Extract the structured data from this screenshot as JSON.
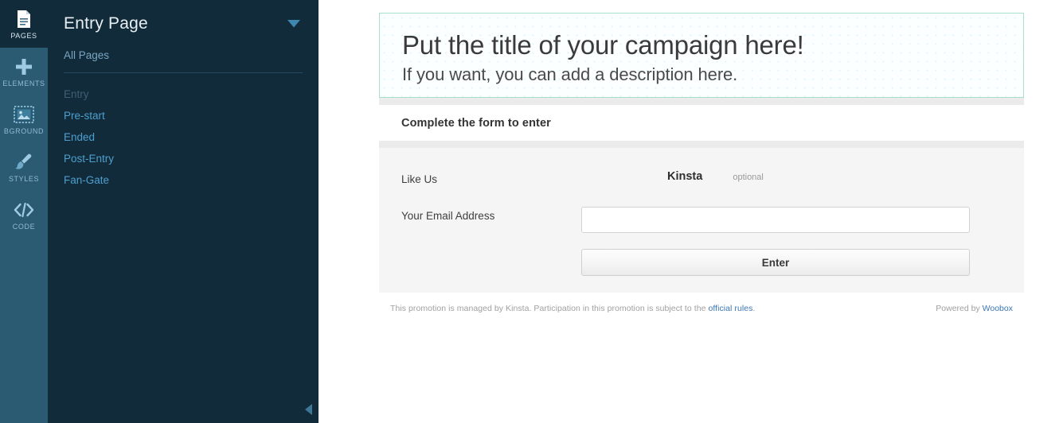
{
  "rail": {
    "items": [
      {
        "label": "PAGES",
        "icon": "document-icon",
        "active": true
      },
      {
        "label": "ELEMENTS",
        "icon": "plus-icon",
        "active": false
      },
      {
        "label": "BGROUND",
        "icon": "image-icon",
        "active": false
      },
      {
        "label": "STYLES",
        "icon": "brush-icon",
        "active": false
      },
      {
        "label": "CODE",
        "icon": "code-icon",
        "active": false
      }
    ]
  },
  "panel": {
    "title": "Entry Page",
    "caret_icon": "chevron-down-icon",
    "all_pages_label": "All Pages",
    "collapse_icon": "chevron-left-icon",
    "pages": [
      {
        "label": "Entry",
        "current": true
      },
      {
        "label": "Pre-start",
        "current": false
      },
      {
        "label": "Ended",
        "current": false
      },
      {
        "label": "Post-Entry",
        "current": false
      },
      {
        "label": "Fan-Gate",
        "current": false
      }
    ]
  },
  "campaign": {
    "banner": {
      "title": "Put the title of your campaign here!",
      "description": "If you want, you can add a description here."
    },
    "form_heading": "Complete the form to enter",
    "fields": {
      "like": {
        "label": "Like Us",
        "brand": "Kinsta",
        "optional": "optional"
      },
      "email": {
        "label": "Your Email Address",
        "value": "",
        "placeholder": ""
      }
    },
    "submit_label": "Enter",
    "footer": {
      "text_before": "This promotion is managed by Kinsta. Participation in this promotion is subject to the ",
      "rules_link": "official rules",
      "text_after": ".",
      "powered_prefix": "Powered by ",
      "powered_link": "Woobox"
    }
  },
  "colors": {
    "rail_bg": "#2b5a73",
    "panel_bg": "#122b3b",
    "link_blue": "#4d9fce",
    "banner_border": "#a9e0cc",
    "form_bg": "#f5f5f5"
  }
}
